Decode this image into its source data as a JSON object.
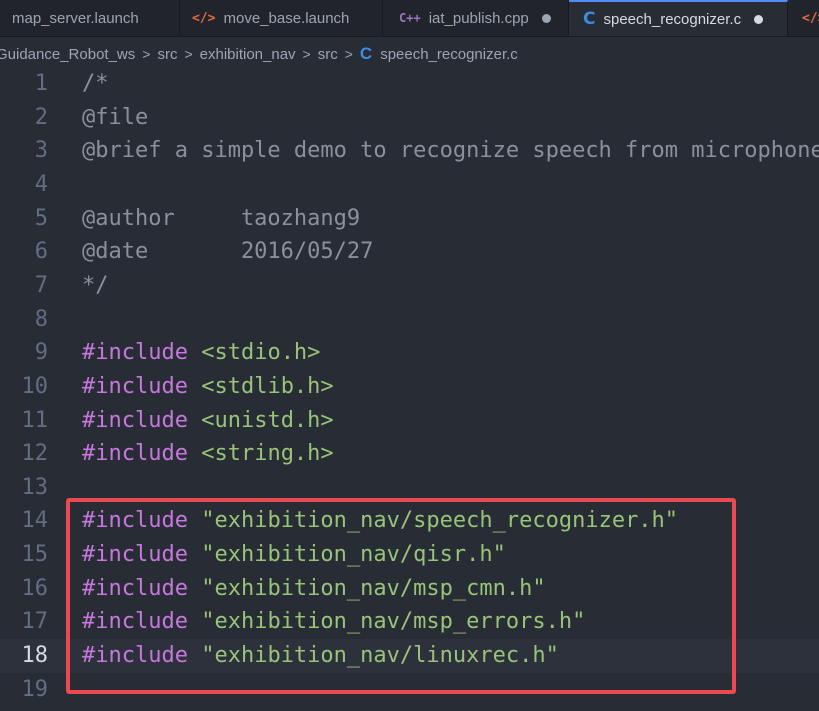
{
  "tabs": [
    {
      "label": "map_server.launch",
      "icon": "xml-icon",
      "icon_text": "</>",
      "active": false,
      "modified": false
    },
    {
      "label": "move_base.launch",
      "icon": "xml-icon",
      "icon_text": "</>",
      "active": false,
      "modified": false
    },
    {
      "label": "iat_publish.cpp",
      "icon": "cpp-icon",
      "icon_text": "C++",
      "active": false,
      "modified": true
    },
    {
      "label": "speech_recognizer.c",
      "icon": "c-file-icon",
      "icon_text": "C",
      "active": true,
      "modified": true
    },
    {
      "label": "",
      "icon": "xml-icon",
      "icon_text": "</>",
      "active": false,
      "modified": false
    }
  ],
  "breadcrumb": {
    "items": [
      "Guidance_Robot_ws",
      "src",
      "exhibition_nav",
      "src",
      "speech_recognizer.c"
    ],
    "separator": ">",
    "file_icon_text": "C"
  },
  "editor": {
    "current_line": 18,
    "lines": [
      {
        "n": "1",
        "parts": [
          {
            "t": "/*",
            "c": "comment"
          }
        ]
      },
      {
        "n": "2",
        "parts": [
          {
            "t": "@file",
            "c": "comment"
          }
        ]
      },
      {
        "n": "3",
        "parts": [
          {
            "t": "@brief a simple demo to recognize speech from microphone",
            "c": "comment"
          }
        ]
      },
      {
        "n": "4",
        "parts": []
      },
      {
        "n": "5",
        "parts": [
          {
            "t": "@author     taozhang9",
            "c": "comment"
          }
        ]
      },
      {
        "n": "6",
        "parts": [
          {
            "t": "@date       2016/05/27",
            "c": "comment"
          }
        ]
      },
      {
        "n": "7",
        "parts": [
          {
            "t": "*/",
            "c": "comment"
          }
        ]
      },
      {
        "n": "8",
        "parts": []
      },
      {
        "n": "9",
        "parts": [
          {
            "t": "#include",
            "c": "kw"
          },
          {
            "t": " ",
            "c": ""
          },
          {
            "t": "<stdio.h>",
            "c": "str"
          }
        ]
      },
      {
        "n": "10",
        "parts": [
          {
            "t": "#include",
            "c": "kw"
          },
          {
            "t": " ",
            "c": ""
          },
          {
            "t": "<stdlib.h>",
            "c": "str"
          }
        ]
      },
      {
        "n": "11",
        "parts": [
          {
            "t": "#include",
            "c": "kw"
          },
          {
            "t": " ",
            "c": ""
          },
          {
            "t": "<unistd.h>",
            "c": "str"
          }
        ]
      },
      {
        "n": "12",
        "parts": [
          {
            "t": "#include",
            "c": "kw"
          },
          {
            "t": " ",
            "c": ""
          },
          {
            "t": "<string.h>",
            "c": "str"
          }
        ]
      },
      {
        "n": "13",
        "parts": []
      },
      {
        "n": "14",
        "parts": [
          {
            "t": "#include",
            "c": "kw"
          },
          {
            "t": " ",
            "c": ""
          },
          {
            "t": "\"exhibition_nav/speech_recognizer.h\"",
            "c": "str"
          }
        ]
      },
      {
        "n": "15",
        "parts": [
          {
            "t": "#include",
            "c": "kw"
          },
          {
            "t": " ",
            "c": ""
          },
          {
            "t": "\"exhibition_nav/qisr.h\"",
            "c": "str"
          }
        ]
      },
      {
        "n": "16",
        "parts": [
          {
            "t": "#include",
            "c": "kw"
          },
          {
            "t": " ",
            "c": ""
          },
          {
            "t": "\"exhibition_nav/msp_cmn.h\"",
            "c": "str"
          }
        ]
      },
      {
        "n": "17",
        "parts": [
          {
            "t": "#include",
            "c": "kw"
          },
          {
            "t": " ",
            "c": ""
          },
          {
            "t": "\"exhibition_nav/msp_errors.h\"",
            "c": "str"
          }
        ]
      },
      {
        "n": "18",
        "parts": [
          {
            "t": "#include",
            "c": "kw"
          },
          {
            "t": " ",
            "c": ""
          },
          {
            "t": "\"exhibition_nav/linuxrec.h\"",
            "c": "str"
          }
        ]
      },
      {
        "n": "19",
        "parts": []
      }
    ]
  },
  "colors": {
    "background": "#282c34",
    "keyword": "#c678dd",
    "string": "#98c379",
    "comment": "#8a919d",
    "highlight_box": "#e84a4f"
  }
}
